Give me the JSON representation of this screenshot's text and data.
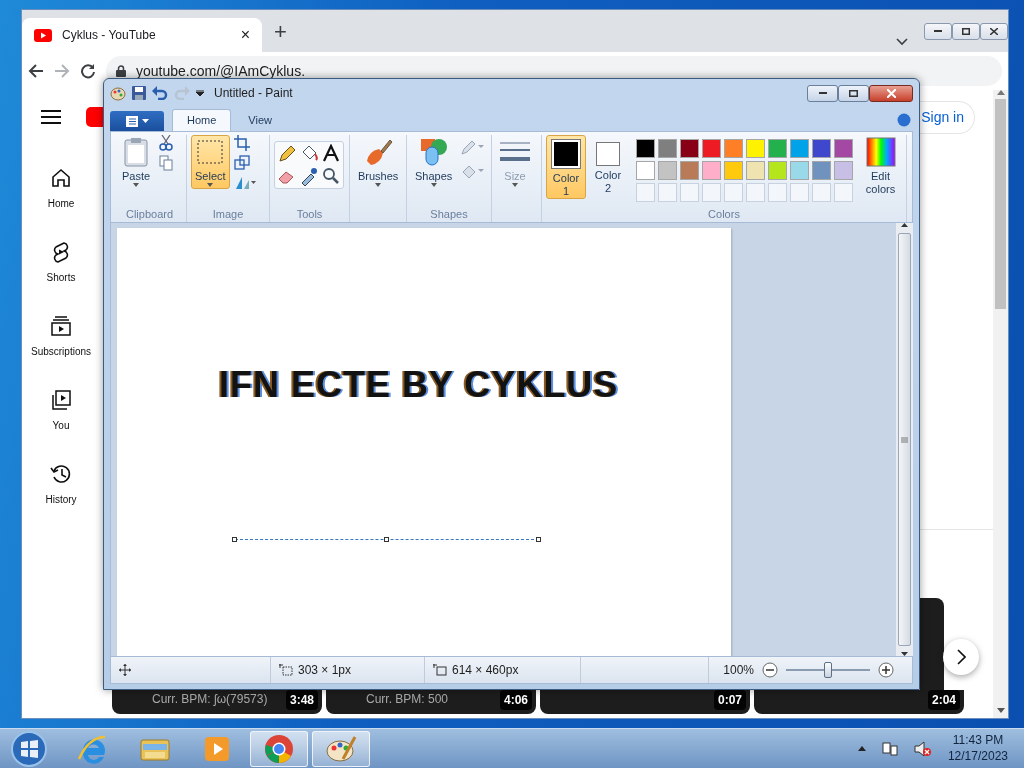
{
  "browser": {
    "tab": {
      "title": "Cyklus - YouTube",
      "close": "×"
    },
    "new_tab": "+",
    "address": "youtube.com/@IAmCyklus."
  },
  "youtube": {
    "sidebar": [
      {
        "kind": "home",
        "label": "Home"
      },
      {
        "kind": "shorts",
        "label": "Shorts"
      },
      {
        "kind": "subscriptions",
        "label": "Subscriptions"
      },
      {
        "kind": "you",
        "label": "You"
      },
      {
        "kind": "history",
        "label": "History"
      }
    ],
    "sign_in": "Sign in",
    "videos": [
      {
        "caption": "Curr. BPM: ʃω(79573)",
        "duration": "3:48"
      },
      {
        "caption": "Curr. BPM: 500",
        "duration": "4:06"
      },
      {
        "duration": "0:07"
      },
      {
        "duration": "2:04"
      }
    ]
  },
  "paint": {
    "title": "Untitled - Paint",
    "tabs": [
      {
        "label": "Home",
        "selected": true
      },
      {
        "label": "View",
        "selected": false
      }
    ],
    "clipboard": {
      "label": "Clipboard",
      "paste": "Paste"
    },
    "image": {
      "label": "Image",
      "select": {
        "label": "Select",
        "selected": true
      }
    },
    "tools": {
      "label": "Tools"
    },
    "brushes": {
      "label": "Brushes"
    },
    "shapes": {
      "label": "Shapes",
      "button": "Shapes"
    },
    "size": {
      "label": "Size",
      "disabled": true
    },
    "colors": {
      "label": "Colors",
      "edit": "Edit colors",
      "slots": [
        {
          "label": "Color 1",
          "color": "#000000",
          "selected": true
        },
        {
          "label": "Color 2",
          "color": "#ffffff",
          "selected": false
        }
      ],
      "palette": [
        {
          "kind": "swatch",
          "color": "#000000"
        },
        {
          "kind": "swatch",
          "color": "#7f7f7f"
        },
        {
          "kind": "swatch",
          "color": "#880015"
        },
        {
          "kind": "swatch",
          "color": "#ed1c24"
        },
        {
          "kind": "swatch",
          "color": "#ff7f27"
        },
        {
          "kind": "swatch",
          "color": "#fff200"
        },
        {
          "kind": "swatch",
          "color": "#22b14c"
        },
        {
          "kind": "swatch",
          "color": "#00a2e8"
        },
        {
          "kind": "swatch",
          "color": "#3f48cc"
        },
        {
          "kind": "swatch",
          "color": "#a349a4"
        },
        {
          "kind": "swatch",
          "color": "#ffffff"
        },
        {
          "kind": "swatch",
          "color": "#c3c3c3"
        },
        {
          "kind": "swatch",
          "color": "#b97a57"
        },
        {
          "kind": "swatch",
          "color": "#ffaec9"
        },
        {
          "kind": "swatch",
          "color": "#ffc90e"
        },
        {
          "kind": "swatch",
          "color": "#efe4b0"
        },
        {
          "kind": "swatch",
          "color": "#b5e61d"
        },
        {
          "kind": "swatch",
          "color": "#99d9ea"
        },
        {
          "kind": "swatch",
          "color": "#7092be"
        },
        {
          "kind": "swatch",
          "color": "#c8bfe7"
        },
        {
          "kind": "empty"
        },
        {
          "kind": "empty"
        },
        {
          "kind": "empty"
        },
        {
          "kind": "empty"
        },
        {
          "kind": "empty"
        },
        {
          "kind": "empty"
        },
        {
          "kind": "empty"
        },
        {
          "kind": "empty"
        },
        {
          "kind": "empty"
        },
        {
          "kind": "empty"
        }
      ]
    },
    "canvas_text": "IFN ECTE BY CYKLUS",
    "status": {
      "selection_size": "303 × 1px",
      "image_size": "614 × 460px",
      "zoom": {
        "reading": "100%",
        "level": 0.5
      }
    }
  },
  "taskbar": {
    "apps": [
      {
        "kind": "ie",
        "active": false
      },
      {
        "kind": "explorer",
        "active": false
      },
      {
        "kind": "media",
        "active": false
      },
      {
        "kind": "chrome",
        "active": true
      },
      {
        "kind": "paint",
        "active": true
      }
    ],
    "time": "11:43 PM",
    "date": "12/17/2023"
  }
}
